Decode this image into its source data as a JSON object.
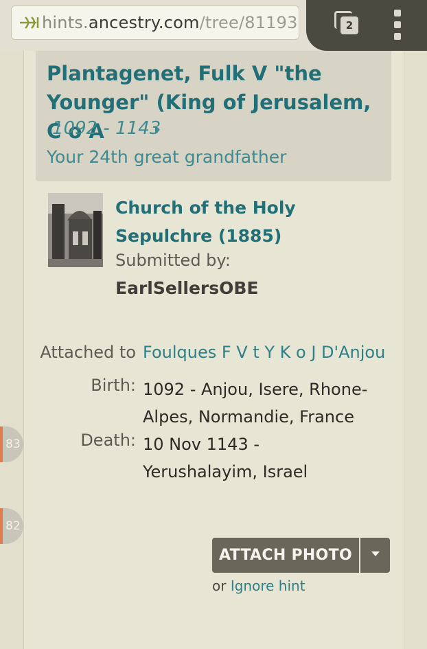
{
  "browser": {
    "url_prefix": "hints.",
    "url_domain": "ancestry.com",
    "url_path": "/tree/81193",
    "tab_count": "2"
  },
  "hint": {
    "person_name": "Plantagenet, Fulk V \"the Younger\" (King of Jerusalem, C o A",
    "dates": "1092 - 1143",
    "relationship": "Your 24th great grandfather"
  },
  "photo": {
    "title": "Church of the Holy Sepulchre (1885)",
    "submitted_label": "Submitted by:",
    "submitter": "EarlSellersOBE"
  },
  "details": {
    "attached_label": "Attached to",
    "attached_value": "Foulques F V t Y K o J D'Anjou",
    "birth_label": "Birth:",
    "birth_value": "1092 - Anjou, Isere, Rhone-Alpes, Normandie, France",
    "death_label": "Death:",
    "death_value": "10 Nov 1143 - Yerushalayim, Israel"
  },
  "side_badges": [
    "83",
    "82"
  ],
  "actions": {
    "attach_label": "ATTACH PHOTO",
    "or_text": "or",
    "ignore_label": "Ignore hint"
  },
  "colors": {
    "accent": "#226f78",
    "button": "#69675a",
    "badge_stripe": "#e07c4d"
  }
}
